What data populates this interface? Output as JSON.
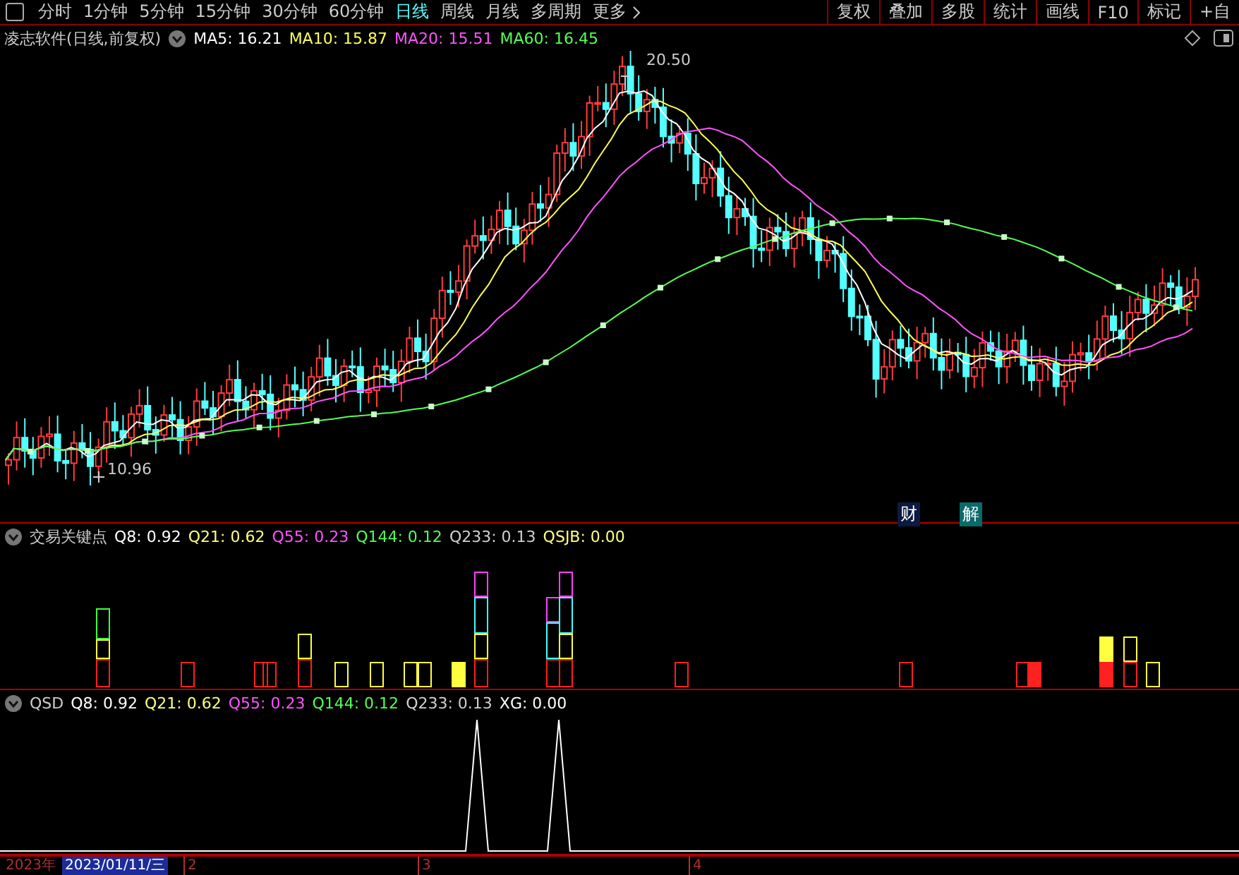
{
  "toolbar": {
    "periods": [
      {
        "label": "分时",
        "selected": false
      },
      {
        "label": "1分钟",
        "selected": false
      },
      {
        "label": "5分钟",
        "selected": false
      },
      {
        "label": "15分钟",
        "selected": false
      },
      {
        "label": "30分钟",
        "selected": false
      },
      {
        "label": "60分钟",
        "selected": false
      },
      {
        "label": "日线",
        "selected": true
      },
      {
        "label": "周线",
        "selected": false
      },
      {
        "label": "月线",
        "selected": false
      },
      {
        "label": "多周期",
        "selected": false
      },
      {
        "label": "更多",
        "selected": false
      }
    ],
    "buttons": [
      "复权",
      "叠加",
      "多股",
      "统计",
      "画线",
      "F10",
      "标记",
      "+自"
    ]
  },
  "chart_header": {
    "title": "凌志软件(日线,前复权)",
    "indicators": [
      {
        "name": "MA5:",
        "value": "16.21",
        "color": "#ffffff"
      },
      {
        "name": "MA10:",
        "value": "15.87",
        "color": "#ffff54"
      },
      {
        "name": "MA20:",
        "value": "15.51",
        "color": "#ff54ff"
      },
      {
        "name": "MA60:",
        "value": "16.45",
        "color": "#54ff54"
      }
    ]
  },
  "price_chart": {
    "high_label": "20.50",
    "low_label": "10.96",
    "badges": [
      {
        "label": "财",
        "kind": "finance"
      },
      {
        "label": "解",
        "kind": "unlock"
      }
    ]
  },
  "indicator_panels": [
    {
      "title": "交易关键点",
      "kind": "bars",
      "values": [
        {
          "name": "Q8:",
          "value": "0.92",
          "color": "#ffffff"
        },
        {
          "name": "Q21:",
          "value": "0.62",
          "color": "#ffff80"
        },
        {
          "name": "Q55:",
          "value": "0.23",
          "color": "#ff54ff"
        },
        {
          "name": "Q144:",
          "value": "0.12",
          "color": "#54ff54"
        },
        {
          "name": "Q233:",
          "value": "0.13",
          "color": "#d0d0d0"
        },
        {
          "name": "QSJB:",
          "value": "0.00",
          "color": "#ffff80"
        }
      ]
    },
    {
      "title": "QSD",
      "kind": "line",
      "values": [
        {
          "name": "Q8:",
          "value": "0.92",
          "color": "#ffffff"
        },
        {
          "name": "Q21:",
          "value": "0.62",
          "color": "#ffff80"
        },
        {
          "name": "Q55:",
          "value": "0.23",
          "color": "#ff54ff"
        },
        {
          "name": "Q144:",
          "value": "0.12",
          "color": "#54ff54"
        },
        {
          "name": "Q233:",
          "value": "0.13",
          "color": "#d0d0d0"
        },
        {
          "name": "XG:",
          "value": "0.00",
          "color": "#ffffff"
        }
      ]
    }
  ],
  "time_axis": {
    "year": "2023年",
    "cursor_date": "2023/01/11/三",
    "months": [
      "2",
      "3",
      "4"
    ]
  }
}
